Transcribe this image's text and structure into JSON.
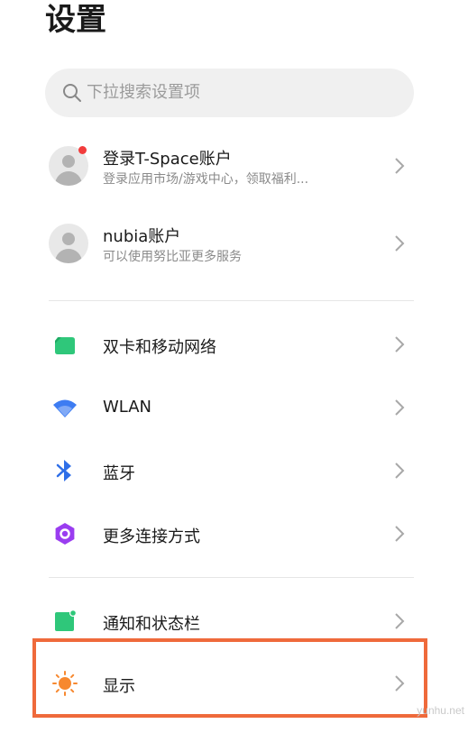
{
  "page": {
    "title": "设置"
  },
  "search": {
    "placeholder": "下拉搜索设置项",
    "icon": "search-icon"
  },
  "accounts": [
    {
      "title": "登录T-Space账户",
      "subtitle": "登录应用市场/游戏中心，领取福利...",
      "has_badge": true
    },
    {
      "title": "nubia账户",
      "subtitle": "可以使用努比亚更多服务",
      "has_badge": false
    }
  ],
  "connectivity": [
    {
      "label": "双卡和移动网络",
      "icon": "sim-card-icon",
      "color": "#2fc77a"
    },
    {
      "label": "WLAN",
      "icon": "wifi-icon",
      "color": "#3d7cf2"
    },
    {
      "label": "蓝牙",
      "icon": "bluetooth-icon",
      "color": "#2f6fe8"
    },
    {
      "label": "更多连接方式",
      "icon": "more-connections-icon",
      "color": "#9a3df0"
    }
  ],
  "system": [
    {
      "label": "通知和状态栏",
      "icon": "notification-icon",
      "color": "#2fc77a"
    },
    {
      "label": "显示",
      "icon": "brightness-sun-icon",
      "color": "#f7882f"
    }
  ],
  "highlight_color": "#ef6a3b",
  "watermark": "yunhu.net"
}
